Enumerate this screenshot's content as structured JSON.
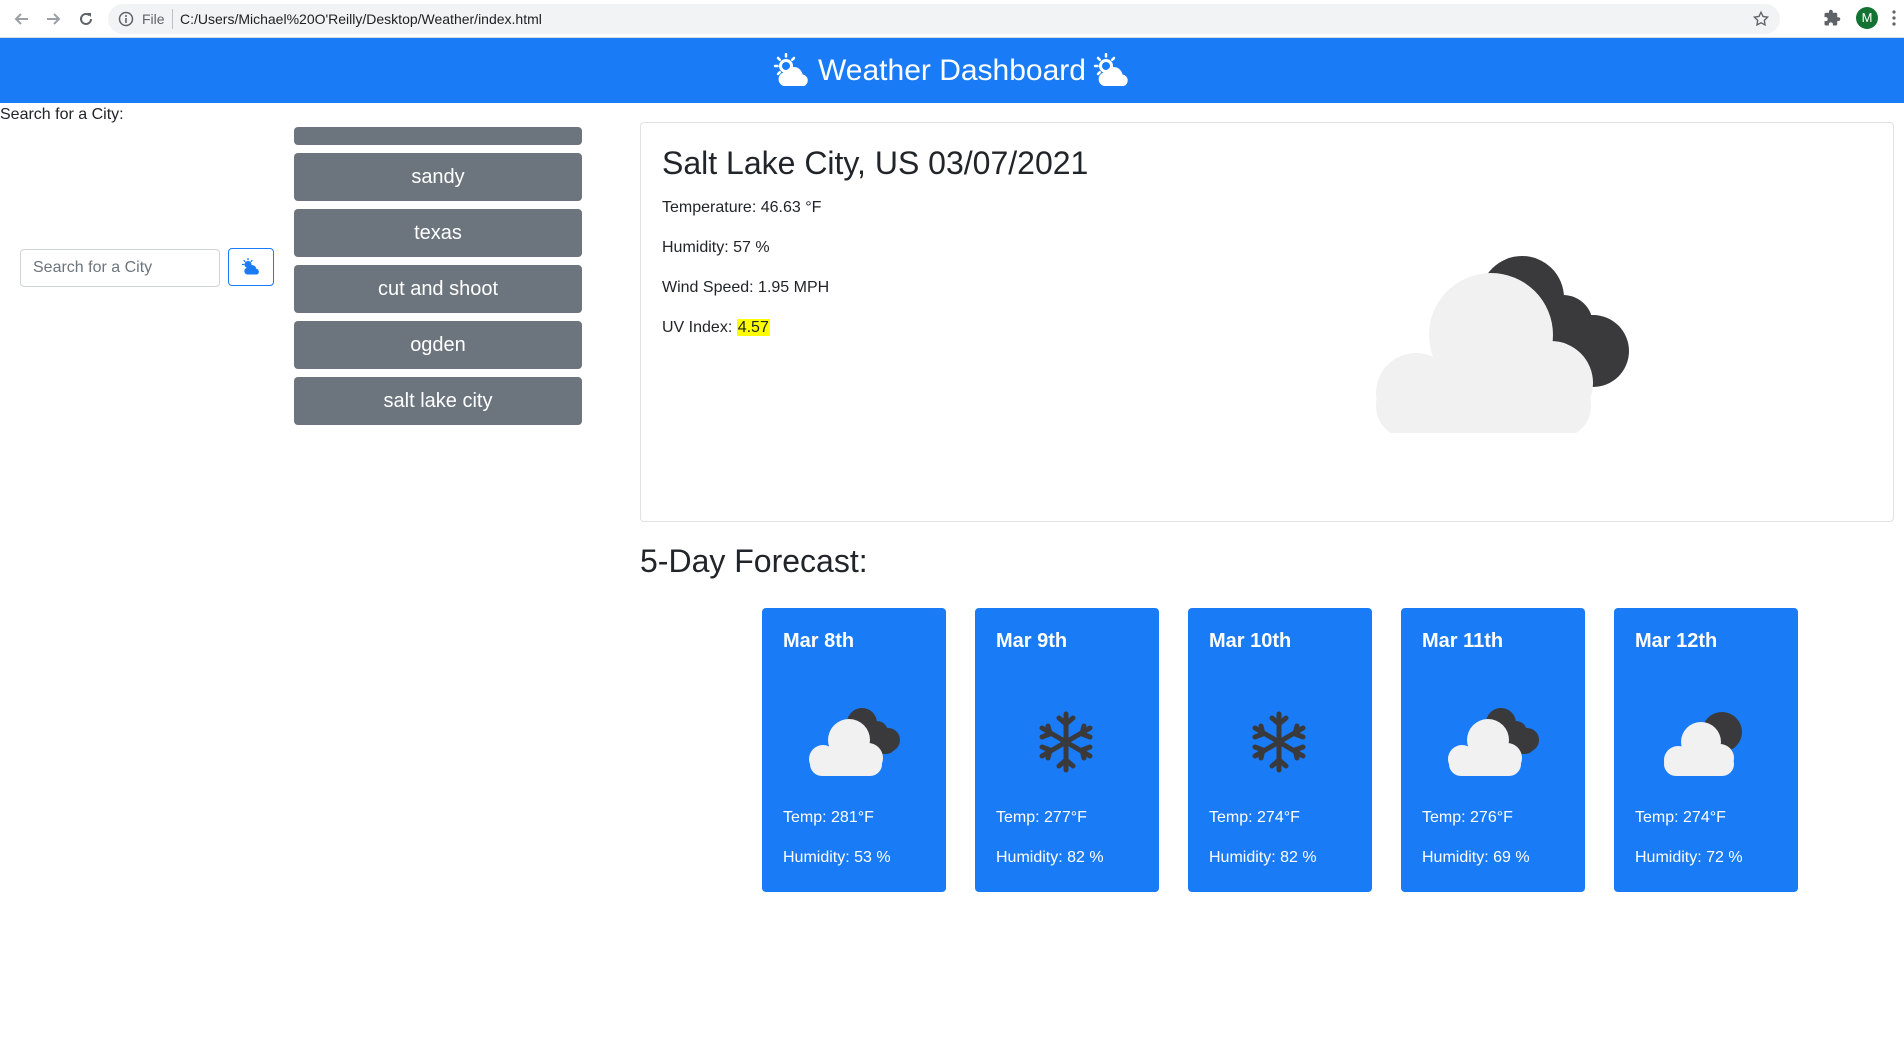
{
  "browser": {
    "scheme": "File",
    "url": "C:/Users/Michael%20O'Reilly/Desktop/Weather/index.html",
    "profile_initial": "M"
  },
  "header": {
    "title": "Weather Dashboard",
    "icon": "cloud-sun-icon",
    "color": "#1a7bf7"
  },
  "search": {
    "label": "Search for a City:",
    "placeholder": "Search for a City",
    "value": "",
    "button_icon": "cloud-sun-icon"
  },
  "history": {
    "items": [
      "sandy",
      "texas",
      "cut and shoot",
      "ogden",
      "salt lake city"
    ]
  },
  "current": {
    "title": "Salt Lake City, US 03/07/2021",
    "temperature": "Temperature: 46.63 °F",
    "humidity": "Humidity: 57 %",
    "wind": "Wind Speed: 1.95 MPH",
    "uv_label": "UV Index: ",
    "uv_value": "4.57",
    "icon": "clouds-icon"
  },
  "forecast": {
    "heading": "5-Day Forecast:",
    "days": [
      {
        "date": "Mar 8th",
        "icon": "clouds-icon",
        "temp": "Temp: 281°F",
        "humidity": "Humidity: 53 %"
      },
      {
        "date": "Mar 9th",
        "icon": "snowflake-icon",
        "temp": "Temp: 277°F",
        "humidity": "Humidity: 82 %"
      },
      {
        "date": "Mar 10th",
        "icon": "snowflake-icon",
        "temp": "Temp: 274°F",
        "humidity": "Humidity: 82 %"
      },
      {
        "date": "Mar 11th",
        "icon": "clouds-icon",
        "temp": "Temp: 276°F",
        "humidity": "Humidity: 69 %"
      },
      {
        "date": "Mar 12th",
        "icon": "cloud-moon-icon",
        "temp": "Temp: 274°F",
        "humidity": "Humidity: 72 %"
      }
    ]
  }
}
